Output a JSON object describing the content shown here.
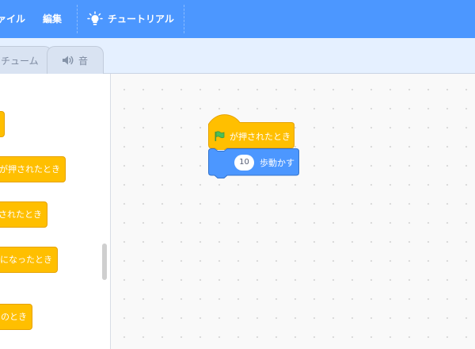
{
  "menubar": {
    "file_label": "ァイル",
    "edit_label": "編集",
    "tutorial_label": "チュートリアル",
    "tutorial_icon": "lightbulb-icon"
  },
  "tabs": {
    "costume_label": "チューム",
    "sound_label": "音",
    "sound_icon": "speaker-icon"
  },
  "palette": {
    "blocks": [
      {
        "label": ""
      },
      {
        "label": "が押されたとき"
      },
      {
        "label": "されたとき"
      },
      {
        "label": "になったとき"
      },
      {
        "label": "のとき"
      }
    ]
  },
  "script": {
    "hat_label": "が押されたとき",
    "hat_icon": "green-flag-icon",
    "move_value": "10",
    "move_label": "歩動かす"
  },
  "colors": {
    "menubar": "#4c97ff",
    "events": "#ffbf00",
    "motion": "#4c97ff",
    "flag": "#4cbf56"
  }
}
